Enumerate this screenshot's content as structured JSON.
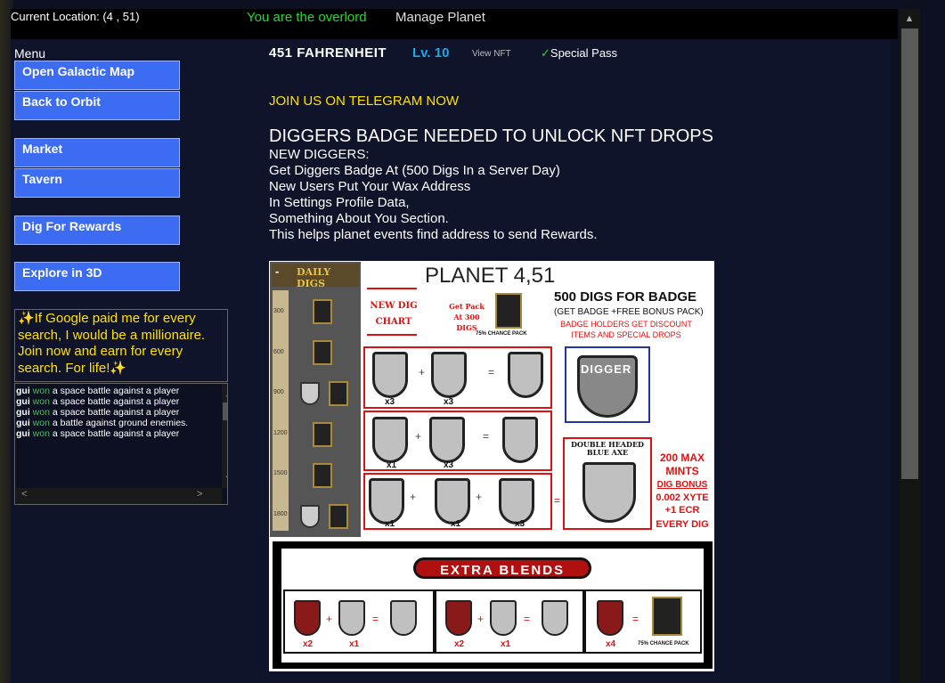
{
  "topbar": {
    "location": "Current Location: (4 , 51)",
    "overlord": "You are the overlord",
    "manage": "Manage Planet"
  },
  "menu": {
    "title": "Menu",
    "buttons": [
      {
        "label": "Open Galactic Map"
      },
      {
        "label": "Back to Orbit"
      },
      {
        "label": "Market"
      },
      {
        "label": "Tavern"
      },
      {
        "label": "Dig For Rewards"
      },
      {
        "label": "Explore in 3D"
      }
    ]
  },
  "promo": {
    "text": "✨If Google paid me for every search, I would be a millionaire. Join now and earn for every search. For life!✨"
  },
  "log": [
    {
      "name": "gui",
      "verb": "won",
      "text": "a space battle against a player"
    },
    {
      "name": "gui",
      "verb": "won",
      "text": "a space battle against a player"
    },
    {
      "name": "gui",
      "verb": "won",
      "text": "a space battle against a player"
    },
    {
      "name": "gui",
      "verb": "won",
      "text": "a battle against ground enemies."
    },
    {
      "name": "gui",
      "verb": "won",
      "text": "a space battle against a player"
    }
  ],
  "header": {
    "planet_name": "451 FAHRENHEIT",
    "level": "Lv. 10",
    "view_nft": "View NFT",
    "pass_check": "✓",
    "pass": "Special Pass"
  },
  "telegram": "JOIN US ON TELEGRAM NOW",
  "heading": "DIGGERS BADGE NEEDED TO UNLOCK NFT DROPS",
  "info_lines": [
    "NEW DIGGERS:",
    "Get Diggers Badge At (500 Digs In a Server Day)",
    "New Users Put Your Wax Address",
    "In Settings Profile Data,",
    "Something About You Section.",
    "This helps planet events find address to send Rewards."
  ],
  "poster": {
    "daily_digs": "DAILY DIGS",
    "minus": "-",
    "ticks": [
      "300",
      "600",
      "900",
      "1200",
      "1500",
      "1800"
    ],
    "planet_title": "PLANET 4,51",
    "new_dig_chart": "NEW DIG CHART",
    "get_pack": "Get Pack At 300 DIGS",
    "chance_pack": "75% CHANCE PACK",
    "digs_for_badge": "500 DIGS FOR BADGE",
    "get_badge": "(GET BADGE +FREE BONUS PACK)",
    "badge_holders": "BADGE HOLDERS GET DISCOUNT ITEMS AND SPECIAL DROPS",
    "digger": "DIGGER",
    "x3": "x3",
    "x1": "x1",
    "double_axe": "DOUBLE HEADED BLUE AXE",
    "max_mints": "200 MAX MINTS",
    "dig_bonus": "DIG BONUS",
    "bonus_xyte": "0.002 XYTE",
    "bonus_ecr": "+1 ECR",
    "every_dig": "EVERY DIG",
    "extra_blends": "EXTRA BLENDS",
    "x2": "x2",
    "x4": "x4",
    "eb_chance": "75% CHANCE PACK"
  }
}
